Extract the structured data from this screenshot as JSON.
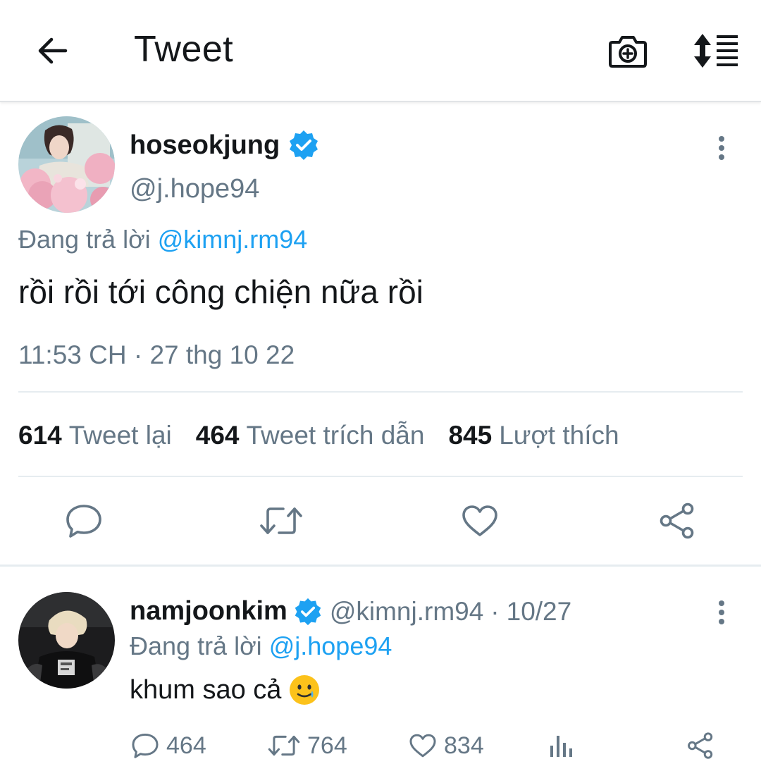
{
  "header": {
    "title": "Tweet",
    "icons": {
      "back": "arrow-left-icon",
      "camera": "camera-plus-icon",
      "sort": "sort-lines-icon"
    }
  },
  "tweet": {
    "display_name": "hoseokjung",
    "handle": "@j.hope94",
    "verified": true,
    "replying_prefix": "Đang trả lời",
    "replying_to": "@kimnj.rm94",
    "text": "rồi rồi tới công chiện nữa rồi",
    "timestamp": "11:53 CH · 27 thg 10 22",
    "stats": {
      "retweets": {
        "count": "614",
        "label": "Tweet lại"
      },
      "quotes": {
        "count": "464",
        "label": "Tweet trích dẫn"
      },
      "likes": {
        "count": "845",
        "label": "Lượt thích"
      }
    },
    "actions": [
      "reply-icon",
      "retweet-icon",
      "like-icon",
      "share-icon"
    ]
  },
  "reply": {
    "display_name": "namjoonkim",
    "handle": "@kimnj.rm94",
    "separator": "·",
    "date": "10/27",
    "verified": true,
    "replying_prefix": "Đang trả lời",
    "replying_to": "@j.hope94",
    "text": "khum sao cả",
    "emoji": "smiling-face-with-tear-icon",
    "counts": {
      "replies": "464",
      "retweets": "764",
      "likes": "834"
    }
  },
  "colors": {
    "accent": "#1da1f2",
    "muted": "#657786",
    "text": "#14171a",
    "divider": "#e6ecf0"
  }
}
